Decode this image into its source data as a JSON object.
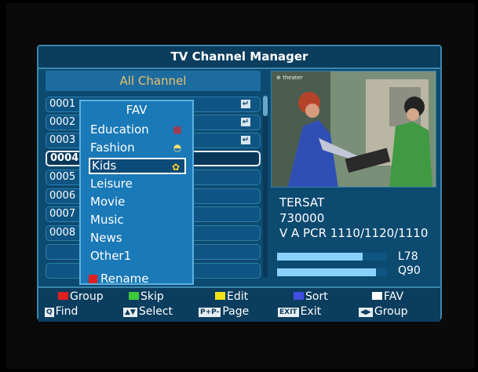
{
  "title": "TV Channel Manager",
  "list_header": "All Channel",
  "channels": [
    {
      "num": "0001",
      "edit_icon": true
    },
    {
      "num": "0002",
      "edit_icon": true
    },
    {
      "num": "0003",
      "edit_icon": true
    },
    {
      "num": "0004",
      "selected": true
    },
    {
      "num": "0005"
    },
    {
      "num": "0006"
    },
    {
      "num": "0007"
    },
    {
      "num": "0008"
    },
    {
      "num": ""
    },
    {
      "num": ""
    }
  ],
  "fav_popup": {
    "title": "FAV",
    "items": [
      {
        "label": "Education",
        "icon": "education-icon",
        "glyph": "▦",
        "color": "#e02020"
      },
      {
        "label": "Fashion",
        "icon": "fashion-icon",
        "glyph": "◓",
        "color": "#ffe070"
      },
      {
        "label": "Kids",
        "icon": "kids-icon",
        "glyph": "✿",
        "color": "#ffd21f",
        "selected": true
      },
      {
        "label": "Leisure"
      },
      {
        "label": "Movie"
      },
      {
        "label": "Music"
      },
      {
        "label": "News"
      },
      {
        "label": "Other1"
      }
    ],
    "rename_label": "Rename"
  },
  "preview_logo": "⊕ theater",
  "info": {
    "satellite": "TERSAT",
    "frequency": "730000",
    "pids": "V A PCR 1110/1120/1110"
  },
  "signal": {
    "level_label": "L78",
    "quality_label": "Q90",
    "level": 0.78,
    "quality": 0.9
  },
  "legend_row1": [
    {
      "label": "Group",
      "color": "#e02020"
    },
    {
      "label": "Skip",
      "color": "#3cc83c"
    },
    {
      "label": "Edit",
      "color": "#f2e21a"
    },
    {
      "label": "Sort",
      "color": "#3f4fe0"
    },
    {
      "label": "FAV",
      "color": "#ffffff"
    }
  ],
  "legend_row2": [
    {
      "key": "Q",
      "label": "Find"
    },
    {
      "key": "▲▼",
      "label": "Select"
    },
    {
      "key": "P+P-",
      "label": "Page"
    },
    {
      "key": "EXIT",
      "label": "Exit"
    },
    {
      "key": "◀▶",
      "label": "Group"
    }
  ]
}
